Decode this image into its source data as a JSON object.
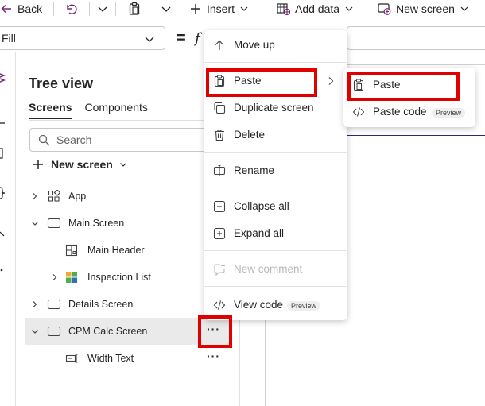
{
  "toolbar": {
    "back_label": "Back",
    "insert_label": "Insert",
    "add_data_label": "Add data",
    "new_screen_label": "New screen"
  },
  "formula_bar": {
    "property_value": "Fill",
    "equals": "=",
    "fx": "f"
  },
  "tree_view": {
    "title": "Tree view",
    "tabs": [
      "Screens",
      "Components"
    ],
    "search_placeholder": "Search",
    "new_screen_label": "New screen",
    "nodes": {
      "app": "App",
      "main_screen": "Main Screen",
      "main_header": "Main Header",
      "inspection_list": "Inspection List",
      "details_screen": "Details Screen",
      "cpm_calc_screen": "CPM Calc Screen",
      "width_text": "Width Text"
    },
    "more_glyph": "···"
  },
  "context_menu": {
    "move_up": "Move up",
    "paste": "Paste",
    "duplicate_screen": "Duplicate screen",
    "delete": "Delete",
    "rename": "Rename",
    "collapse_all": "Collapse all",
    "expand_all": "Expand all",
    "new_comment": "New comment",
    "view_code": "View code",
    "preview_badge": "Preview"
  },
  "paste_submenu": {
    "paste": "Paste",
    "paste_code": "Paste code",
    "preview_badge": "Preview"
  },
  "colors": {
    "highlight": "#e00000",
    "accent_purple": "#742774",
    "selected_row": "#eaeaea"
  }
}
